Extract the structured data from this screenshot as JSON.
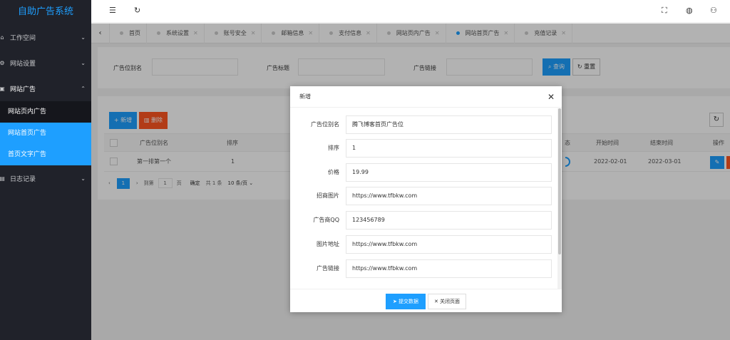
{
  "app": {
    "title": "自助广告系统"
  },
  "sidebar": {
    "items": [
      {
        "label": "工作空间",
        "arrow": "⌄"
      },
      {
        "label": "网站设置",
        "arrow": "⌄"
      },
      {
        "label": "网站广告",
        "arrow": "⌃"
      },
      {
        "label": "日志记录",
        "arrow": "⌄"
      }
    ],
    "sub_items": [
      {
        "label": "网站页内广告"
      },
      {
        "label": "网站首页广告"
      },
      {
        "label": "首页文字广告"
      }
    ]
  },
  "tabs": [
    {
      "label": "首页"
    },
    {
      "label": "系统设置"
    },
    {
      "label": "账号安全"
    },
    {
      "label": "邮箱信息"
    },
    {
      "label": "支付信息"
    },
    {
      "label": "网站页内广告"
    },
    {
      "label": "网站首页广告"
    },
    {
      "label": "充值记录"
    }
  ],
  "search": {
    "alias_label": "广告位别名",
    "title_label": "广告标题",
    "link_label": "广告链接",
    "query_button": "查询",
    "reset_button": "重置"
  },
  "table": {
    "add_button": "新增",
    "delete_button": "删除",
    "columns": {
      "alias": "广告位别名",
      "sort": "排序",
      "status": "态",
      "start": "开始时间",
      "end": "结束时间",
      "actions": "操作"
    },
    "rows": [
      {
        "alias": "第一排第一个",
        "sort": "1",
        "start": "2022-02-01",
        "end": "2022-03-01"
      }
    ],
    "pager": {
      "current": "1",
      "goto_label": "到第",
      "goto_value": "1",
      "page_label": "页",
      "confirm": "确定",
      "total": "共 1 条",
      "per_page": "10 条/页"
    }
  },
  "modal": {
    "title": "新增",
    "fields": [
      {
        "label": "广告位别名",
        "value": "腾飞博客首页广告位"
      },
      {
        "label": "排序",
        "value": "1"
      },
      {
        "label": "价格",
        "value": "19.99"
      },
      {
        "label": "招商图片",
        "value": "https://www.tfbkw.com"
      },
      {
        "label": "广告商QQ",
        "value": "123456789"
      },
      {
        "label": "图片地址",
        "value": "https://www.tfbkw.com"
      },
      {
        "label": "广告链接",
        "value": "https://www.tfbkw.com"
      }
    ],
    "submit": "提交数据",
    "close": "关闭页面"
  },
  "colors": {
    "primary": "#1e9fff",
    "danger": "#ff5722",
    "sidebar_bg": "#20222a"
  }
}
